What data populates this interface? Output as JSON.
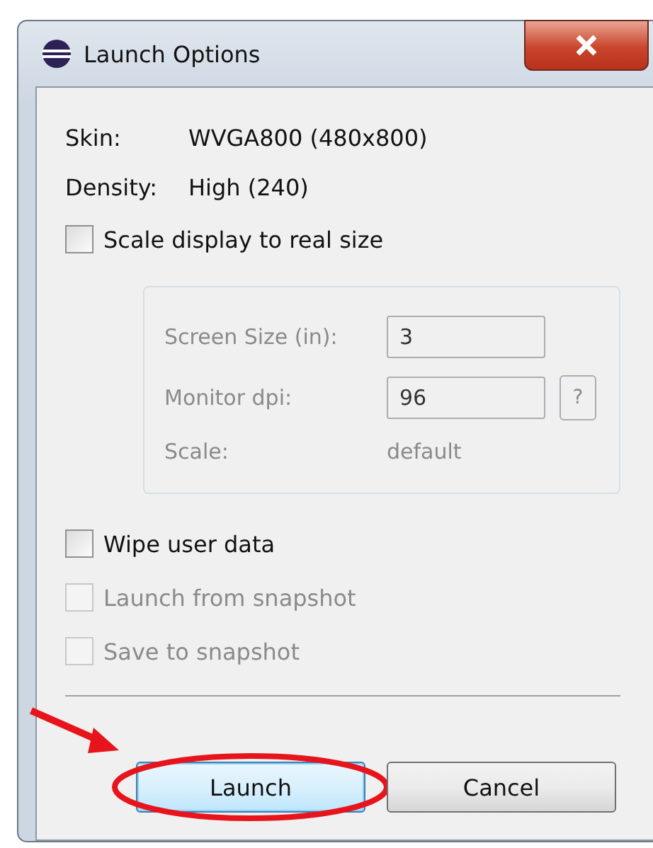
{
  "window": {
    "title": "Launch Options"
  },
  "info": [
    {
      "label": "Skin:",
      "value": "WVGA800 (480x800)"
    },
    {
      "label": "Density:",
      "value": "High (240)"
    }
  ],
  "scale_checkbox": {
    "label": "Scale display to real size",
    "checked": false,
    "disabled": false
  },
  "scale_group": {
    "disabled": true,
    "screen_size": {
      "label": "Screen Size (in):",
      "value": "3"
    },
    "monitor_dpi": {
      "label": "Monitor dpi:",
      "value": "96",
      "help": "?"
    },
    "scale": {
      "label": "Scale:",
      "value": "default"
    }
  },
  "options": [
    {
      "label": "Wipe user data",
      "checked": false,
      "disabled": false
    },
    {
      "label": "Launch from snapshot",
      "checked": false,
      "disabled": true
    },
    {
      "label": "Save to snapshot",
      "checked": false,
      "disabled": true
    }
  ],
  "buttons": [
    {
      "label": "Launch",
      "default": true,
      "highlighted": true
    },
    {
      "label": "Cancel",
      "default": false,
      "highlighted": false
    }
  ]
}
